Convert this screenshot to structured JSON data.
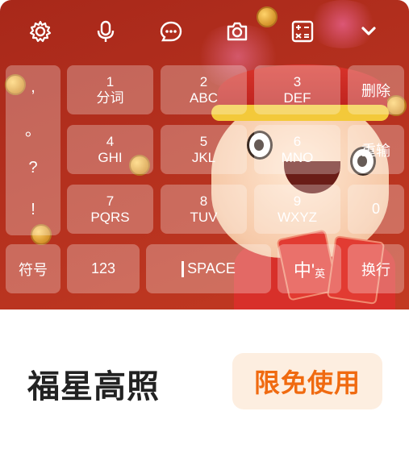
{
  "toolbar": {
    "icons": [
      "gear-icon",
      "microphone-icon",
      "chat-bubble-icon",
      "camera-icon",
      "calculator-icon",
      "chevron-down-icon"
    ]
  },
  "punctuation": [
    ",",
    "。",
    "?",
    "!"
  ],
  "keys": {
    "k1": {
      "num": "1",
      "letters": "分词"
    },
    "k2": {
      "num": "2",
      "letters": "ABC"
    },
    "k3": {
      "num": "3",
      "letters": "DEF"
    },
    "delete": "删除",
    "k4": {
      "num": "4",
      "letters": "GHI"
    },
    "k5": {
      "num": "5",
      "letters": "JKL"
    },
    "k6": {
      "num": "6",
      "letters": "MNO"
    },
    "retype": "重输",
    "k7": {
      "num": "7",
      "letters": "PQRS"
    },
    "k8": {
      "num": "8",
      "letters": "TUV"
    },
    "k9": {
      "num": "9",
      "letters": "WXYZ"
    },
    "zero": "0",
    "symbols": "符号",
    "numbers": "123",
    "space": "SPACE",
    "lang_main": "中'",
    "lang_sub": "英",
    "enter": "换行"
  },
  "skin": {
    "title": "福星高照",
    "action": "限免使用"
  },
  "colors": {
    "keyboard_bg": "#b4301e",
    "promo_text": "#f06a10",
    "promo_bg": "#fdeee0"
  }
}
